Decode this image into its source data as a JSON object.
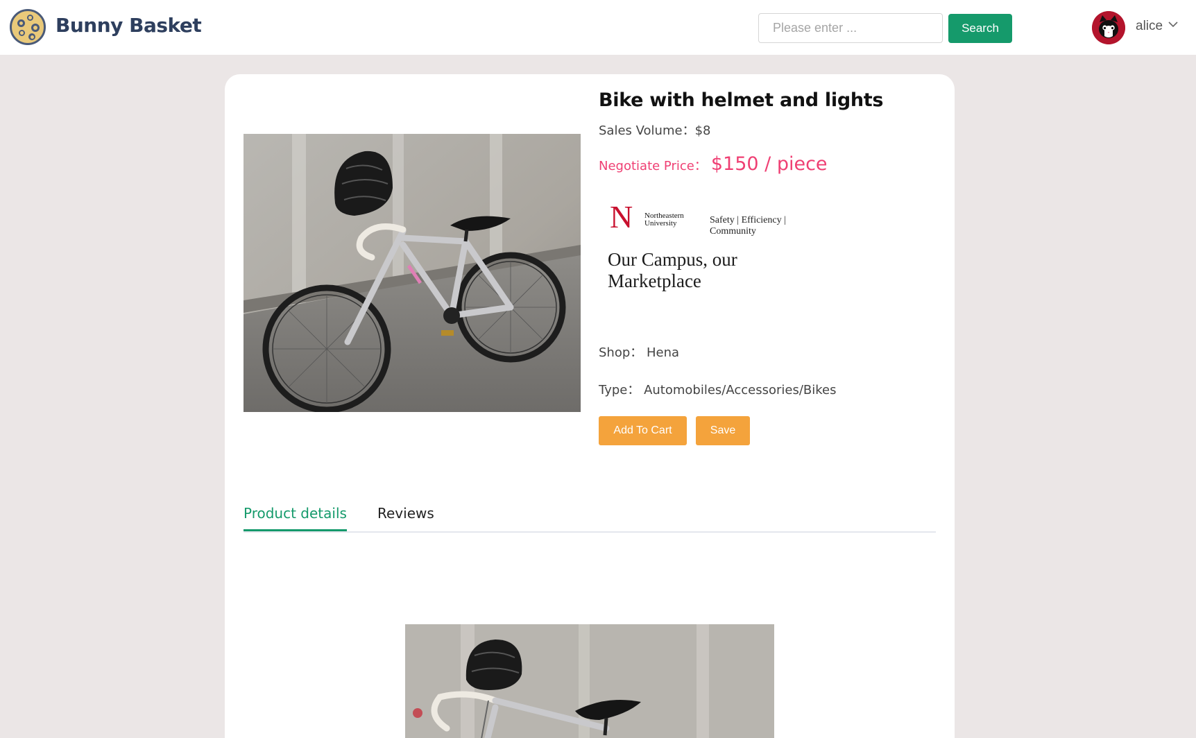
{
  "header": {
    "brand": "Bunny Basket",
    "search_placeholder": "Please enter ...",
    "search_label": "Search",
    "username": "alice"
  },
  "product": {
    "title": "Bike with helmet and lights",
    "sales_volume": "Sales Volume：$8",
    "price_label": "Negotiate Price：",
    "price_value": "$150 / piece",
    "shop": "Shop：  Hena",
    "type": "Type：  Automobiles/Accessories/Bikes",
    "add_to_cart_label": "Add To Cart",
    "save_label": "Save"
  },
  "banner": {
    "univ_line1": "Northeastern",
    "univ_line2": "University",
    "tagline": "Safety | Efficiency | Community",
    "motto": "Our Campus, our Marketplace"
  },
  "tabs": [
    {
      "label": "Product details",
      "active": true
    },
    {
      "label": "Reviews",
      "active": false
    }
  ],
  "colors": {
    "accent": "#159a6b",
    "price": "#ef3f73",
    "button": "#f4a33c",
    "background": "#ebe6e6"
  }
}
